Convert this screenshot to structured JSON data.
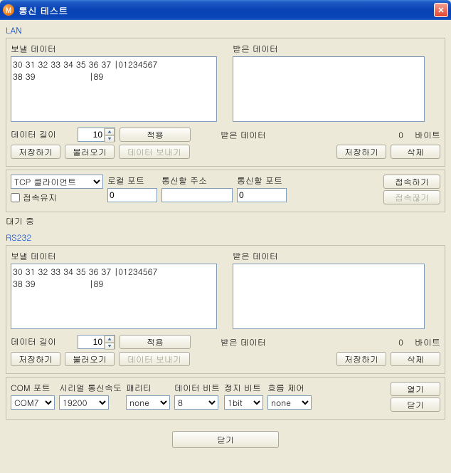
{
  "window": {
    "icon_letter": "M",
    "title": "통신 테스트"
  },
  "lan": {
    "group_label": "LAN",
    "send_label": "보낼 데이터",
    "recv_label": "받은 데이터",
    "send_data": "30 31 32 33 34 35 36 37 |01234567\n38 39                   |89",
    "recv_data": "",
    "data_len_label": "데이터 길이",
    "data_len_value": "10",
    "apply_label": "적용",
    "recv_bytes_label": "받은 데이터",
    "recv_bytes_value": "0",
    "bytes_unit": "바이트",
    "save_label": "저장하기",
    "load_label": "불러오기",
    "send_btn_label": "데이터 보내기",
    "recv_save_label": "저장하기",
    "delete_label": "삭제",
    "mode_value": "TCP 클라이언트",
    "local_port_label": "로컬 포트",
    "local_port_value": "0",
    "remote_addr_label": "통신할 주소",
    "remote_addr_value": "",
    "remote_port_label": "통신할 포트",
    "remote_port_value": "0",
    "connect_label": "접속하기",
    "disconnect_label": "접속끊기",
    "keep_conn_label": "접속유지",
    "status": "대기 중"
  },
  "rs232": {
    "group_label": "RS232",
    "send_label": "보낼 데이터",
    "recv_label": "받은 데이터",
    "send_data": "30 31 32 33 34 35 36 37 |01234567\n38 39                   |89",
    "recv_data": "",
    "data_len_label": "데이터 길이",
    "data_len_value": "10",
    "apply_label": "적용",
    "recv_bytes_label": "받은 데이터",
    "recv_bytes_value": "0",
    "bytes_unit": "바이트",
    "save_label": "저장하기",
    "load_label": "불러오기",
    "send_btn_label": "데이터 보내기",
    "recv_save_label": "저장하기",
    "delete_label": "삭제",
    "com_port_label": "COM 포트",
    "com_port_value": "COM7",
    "baud_label": "시리얼 통신속도",
    "baud_value": "19200",
    "parity_label": "패리티",
    "parity_value": "none",
    "databits_label": "데이터 비트",
    "databits_value": "8",
    "stopbits_label": "정지 비트",
    "stopbits_value": "1bit",
    "flow_label": "흐름 제어",
    "flow_value": "none",
    "open_label": "열기",
    "close_label": "닫기"
  },
  "footer": {
    "close_label": "닫기"
  }
}
